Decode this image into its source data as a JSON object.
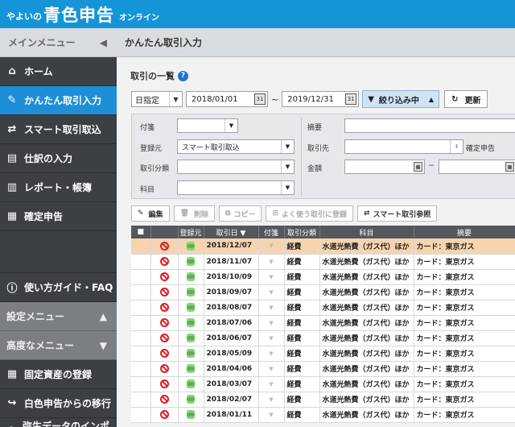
{
  "app": {
    "logo_small": "やよいの",
    "logo_big": "青色申告",
    "logo_online": "オンライン"
  },
  "sidebar": {
    "menu_title": "メインメニュー",
    "items": [
      {
        "label": "ホーム",
        "icon": "home-icon"
      },
      {
        "label": "かんたん取引入力",
        "icon": "pencil-icon",
        "active": true
      },
      {
        "label": "スマート取引取込",
        "icon": "import-icon"
      },
      {
        "label": "仕訳の入力",
        "icon": "journal-icon"
      },
      {
        "label": "レポート・帳簿",
        "icon": "chart-icon"
      },
      {
        "label": "確定申告",
        "icon": "tax-icon"
      }
    ],
    "guide_label": "使い方ガイド・FAQ",
    "settings_label": "設定メニュー",
    "advanced_label": "高度なメニュー",
    "bottom_items": [
      {
        "label": "固定資産の登録",
        "icon": "building-icon"
      },
      {
        "label": "白色申告からの移行",
        "icon": "share-arrow-icon"
      },
      {
        "label": "弥生データのインポート",
        "icon": "person-icon"
      }
    ]
  },
  "main": {
    "page_title": "かんたん取引入力",
    "section_title": "取引の一覧",
    "date_mode": "日指定",
    "date_from": "2018/01/01",
    "date_to": "2019/12/31",
    "tilde": "~",
    "filter_button": "絞り込み中",
    "refresh_button": "更新",
    "filters": {
      "tag_label": "付箋",
      "summary_label": "摘要",
      "source_label": "登録元",
      "source_value": "スマート取引取込",
      "partner_label": "取引先",
      "kakutei_label": "確定申告",
      "category_label": "取引分類",
      "amount_label": "金額",
      "amount_tilde": "~",
      "account_label": "科目"
    },
    "toolbar": {
      "edit": "編集",
      "delete": "削除",
      "copy": "コピー",
      "register_freq": "よく使う取引に登録",
      "smart_ref": "スマート取引参照"
    },
    "table": {
      "headers": [
        "",
        "",
        "登録元",
        "取引日 ▼",
        "付箋",
        "取引分類",
        "科目",
        "摘要"
      ],
      "rows": [
        {
          "date": "2018/12/07",
          "category": "経費",
          "account": "水道光熱費（ガス代）ほか",
          "summary": "カード：東京ガス"
        },
        {
          "date": "2018/11/07",
          "category": "経費",
          "account": "水道光熱費（ガス代）ほか",
          "summary": "カード：東京ガス"
        },
        {
          "date": "2018/10/09",
          "category": "経費",
          "account": "水道光熱費（ガス代）ほか",
          "summary": "カード：東京ガス"
        },
        {
          "date": "2018/09/07",
          "category": "経費",
          "account": "水道光熱費（ガス代）ほか",
          "summary": "カード：東京ガス"
        },
        {
          "date": "2018/08/07",
          "category": "経費",
          "account": "水道光熱費（ガス代）ほか",
          "summary": "カード：東京ガス"
        },
        {
          "date": "2018/07/06",
          "category": "経費",
          "account": "水道光熱費（ガス代）ほか",
          "summary": "カード：東京ガス"
        },
        {
          "date": "2018/06/07",
          "category": "経費",
          "account": "水道光熱費（ガス代）ほか",
          "summary": "カード：東京ガス"
        },
        {
          "date": "2018/05/09",
          "category": "経費",
          "account": "水道光熱費（ガス代）ほか",
          "summary": "カード：東京ガス"
        },
        {
          "date": "2018/04/06",
          "category": "経費",
          "account": "水道光熱費（ガス代）ほか",
          "summary": "カード：東京ガス"
        },
        {
          "date": "2018/03/07",
          "category": "経費",
          "account": "水道光熱費（ガス代）ほか",
          "summary": "カード：東京ガス"
        },
        {
          "date": "2018/02/07",
          "category": "経費",
          "account": "水道光熱費（ガス代）ほか",
          "summary": "カード：東京ガス"
        },
        {
          "date": "2018/01/11",
          "category": "経費",
          "account": "水道光熱費（ガス代）ほか",
          "summary": "カード：東京ガス"
        }
      ]
    }
  },
  "colors": {
    "topbar": "#1595d8",
    "sidebar": "#3c3f43",
    "active": "#1e8fd6",
    "selected_row": "#f6d4b0"
  }
}
